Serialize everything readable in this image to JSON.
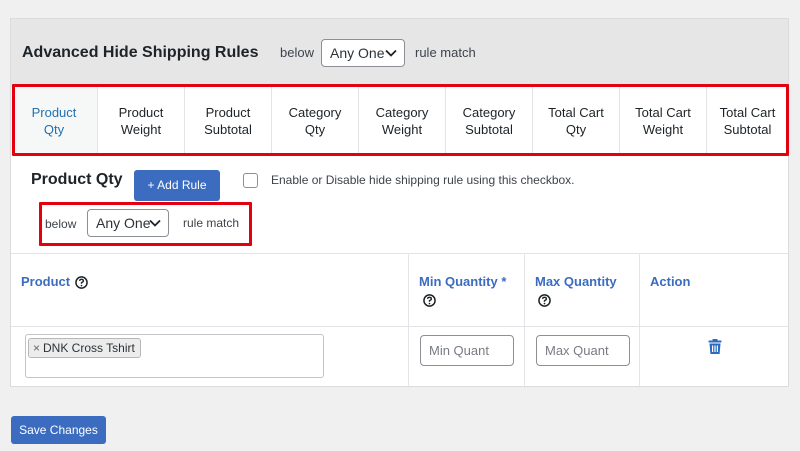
{
  "header": {
    "title": "Advanced Hide Shipping Rules",
    "below_label": "below",
    "match_select_value": "Any One",
    "rule_match_label": "rule match"
  },
  "tabs": [
    {
      "label": "Product\nQty",
      "active": true
    },
    {
      "label": "Product\nWeight"
    },
    {
      "label": "Product\nSubtotal"
    },
    {
      "label": "Category\nQty"
    },
    {
      "label": "Category\nWeight"
    },
    {
      "label": "Category\nSubtotal"
    },
    {
      "label": "Total Cart\nQty"
    },
    {
      "label": "Total Cart\nWeight"
    },
    {
      "label": "Total Cart\nSubtotal"
    }
  ],
  "section": {
    "title": "Product Qty",
    "add_rule_label": "+ Add Rule",
    "checkbox_label": "Enable or Disable hide shipping rule using this checkbox.",
    "below_label": "below",
    "match_select_value": "Any One",
    "rule_match_label": "rule match"
  },
  "table": {
    "headers": {
      "product": "Product",
      "min_quantity": "Min Quantity *",
      "max_quantity": "Max Quantity",
      "action": "Action"
    },
    "row": {
      "product_tag": "DNK Cross Tshirt",
      "tag_remove": "×",
      "min_placeholder": "Min Quant",
      "max_placeholder": "Max Quant"
    }
  },
  "footer": {
    "save_label": "Save Changes"
  },
  "colors": {
    "accent": "#3b6cc0",
    "active_tab": "#2271b1",
    "highlight": "#e3000f"
  }
}
